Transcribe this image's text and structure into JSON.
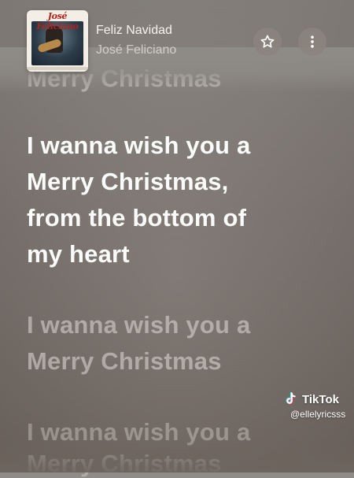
{
  "now_playing": {
    "album_art_text": "José Feliciano",
    "song_title": "Feliz Navidad",
    "artist": "José Feliciano",
    "star_icon": "star-icon",
    "more_icon": "more-vertical-icon"
  },
  "lyrics": {
    "previous_line": "Merry Christmas",
    "active_lines": [
      "I wanna wish you a",
      "Merry Christmas,",
      "from the bottom of",
      "my heart"
    ],
    "upcoming_lines": [
      "I wanna wish you a",
      "Merry Christmas",
      "I wanna wish you a",
      "Merry Christmas"
    ]
  },
  "watermark": {
    "brand": "TikTok",
    "handle": "@ellelyricsss"
  },
  "colors": {
    "active_lyric": "#fbfbfa",
    "dim_lyric": "rgba(225,220,216,0.55)",
    "background_top": "#8f8c88",
    "background_bottom": "#6e655f"
  }
}
